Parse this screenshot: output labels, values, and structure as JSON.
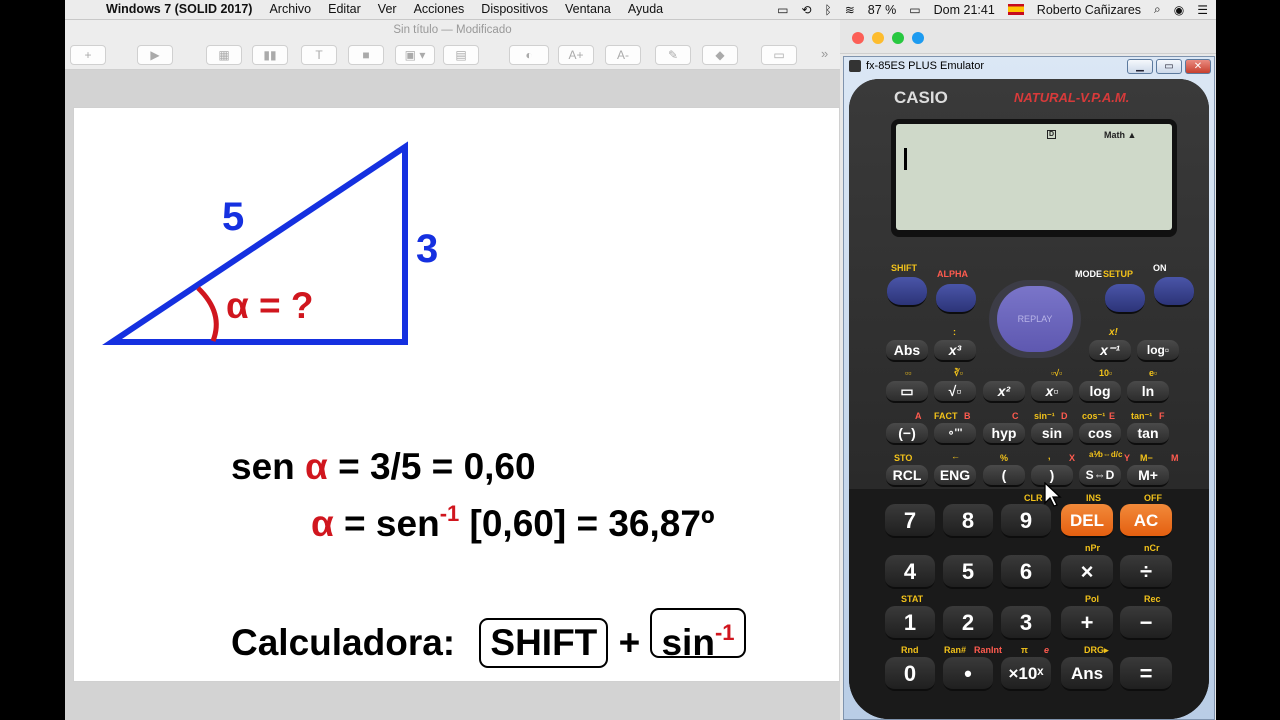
{
  "menubar": {
    "app": "Windows 7 (SOLID 2017)",
    "menus": [
      "Archivo",
      "Editar",
      "Ver",
      "Acciones",
      "Dispositivos",
      "Ventana",
      "Ayuda"
    ],
    "battery": "87 %",
    "clock": "Dom 21:41",
    "user": "Roberto Cañizares"
  },
  "keynote": {
    "title": "Sin título — Modificado",
    "toolbar": {
      "add": "+",
      "text": "T",
      "more": "»",
      "a_plus": "A+",
      "a_minus": "A-"
    }
  },
  "slide": {
    "hyp_label": "5",
    "opp_label": "3",
    "angle_label": "α = ?",
    "eq1_prefix": "sen ",
    "eq1_alpha": "α",
    "eq1_rest": " = 3/5 = 0,60",
    "eq2_alpha": "α",
    "eq2_mid": " = sen",
    "eq2_sup": "-1",
    "eq2_rest": " [0,60] = 36,87º",
    "calc_label": "Calculadora:",
    "key1": "SHIFT",
    "plus": "+",
    "key2": "sin",
    "key2_sup": "-1",
    "colors": {
      "triangle": "#1530e0",
      "alpha": "#d0161e"
    }
  },
  "emulator": {
    "window_title": "fx-85ES PLUS Emulator",
    "brand": "CASIO",
    "model": "NATURAL-V.P.A.M.",
    "lcd": {
      "indicator_d": "D",
      "indicator_math": "Math ▲"
    },
    "replay": "REPLAY",
    "labels": {
      "shift": "SHIFT",
      "alpha": "ALPHA",
      "mode": "MODE",
      "setup": "SETUP",
      "on": "ON"
    },
    "row_fn1": [
      "Abs",
      "x³",
      "x⁻¹",
      "log▫"
    ],
    "row_fn2": [
      "▭",
      "√▫",
      "x²",
      "x▫",
      "log",
      "ln"
    ],
    "row_fn3": [
      "(−)",
      "∘'''",
      "hyp",
      "sin",
      "cos",
      "tan"
    ],
    "row_fn4": [
      "RCL",
      "ENG",
      "(",
      ")",
      "S⇔D",
      "M+"
    ],
    "row_num1": [
      "7",
      "8",
      "9",
      "DEL",
      "AC"
    ],
    "row_num2": [
      "4",
      "5",
      "6",
      "×",
      "÷"
    ],
    "row_num3": [
      "1",
      "2",
      "3",
      "+",
      "−"
    ],
    "row_num4": [
      "0",
      "•",
      "×10ˣ",
      "Ans",
      "="
    ],
    "shift_labels": {
      "r1": [
        ":",
        "x!"
      ],
      "r2": [
        "▫▫",
        "∛▫",
        "▫√▫",
        "10▫",
        "e▫"
      ],
      "r3": [
        "A",
        "FACT",
        "B",
        "C",
        "sin⁻¹",
        "D",
        "cos⁻¹",
        "E",
        "tan⁻¹",
        "F"
      ],
      "r4": [
        "STO",
        "←",
        "%",
        ",",
        "X",
        "a⅟b⇔d/c",
        "Y",
        "M−",
        "M"
      ],
      "r5": [
        "CLR",
        "INS",
        "OFF"
      ],
      "r6": [
        "nPr",
        "nCr"
      ],
      "r7": [
        "STAT",
        "Pol",
        "Rec"
      ],
      "r8": [
        "Rnd",
        "Ran#",
        "RanInt",
        "π",
        "e",
        "DRG▸"
      ]
    }
  }
}
